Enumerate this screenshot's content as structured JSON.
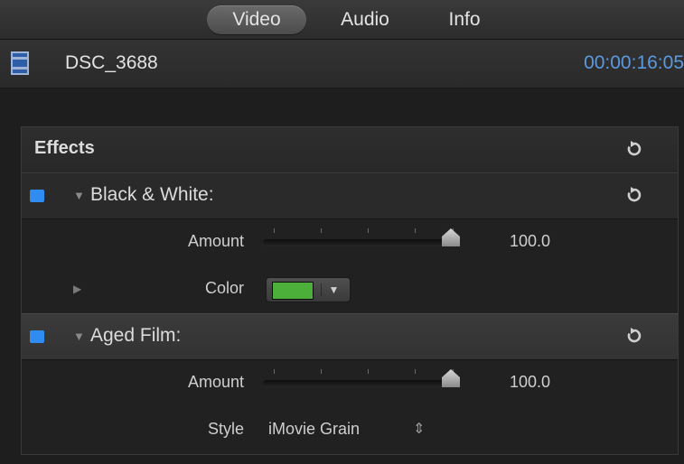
{
  "tabs": [
    {
      "label": "Video",
      "active": true
    },
    {
      "label": "Audio",
      "active": false
    },
    {
      "label": "Info",
      "active": false
    }
  ],
  "clip": {
    "icon": "film-strip-icon",
    "name": "DSC_3688",
    "timecode": "00:00:16:05"
  },
  "effects": {
    "title": "Effects",
    "items": [
      {
        "name": "Black & White:",
        "enabled": true,
        "expanded": true,
        "params": {
          "amount_label": "Amount",
          "amount_value": "100.0",
          "amount_level": 1.0,
          "color_label": "Color",
          "color_value": "#4caf3a"
        }
      },
      {
        "name": "Aged Film:",
        "enabled": true,
        "expanded": true,
        "params": {
          "amount_label": "Amount",
          "amount_value": "100.0",
          "amount_level": 1.0,
          "style_label": "Style",
          "style_value": "iMovie Grain"
        }
      }
    ]
  },
  "colors": {
    "accent_blue": "#2f8cf0",
    "timecode_blue": "#5b9ae0"
  }
}
